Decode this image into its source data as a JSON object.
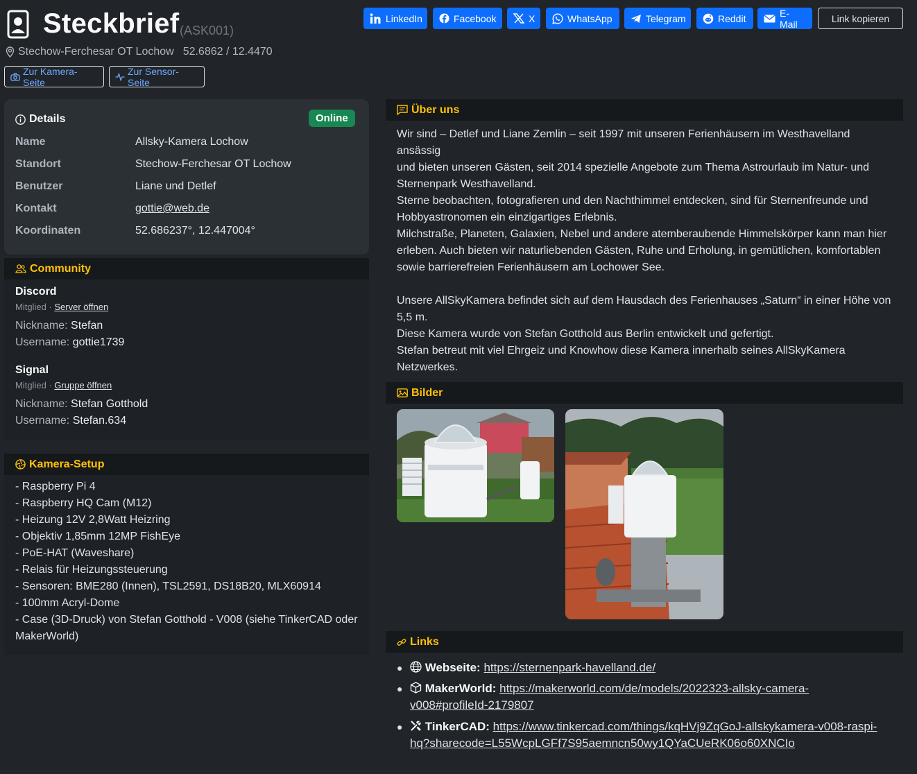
{
  "header": {
    "title": "Steckbrief",
    "camera_id": "(ASK001)",
    "location": "Stechow-Ferchesar OT Lochow",
    "coords_short": "52.6862 / 12.4470",
    "nav": {
      "camera_page": "Zur Kamera-Seite",
      "sensor_page": "Zur Sensor-Seite"
    }
  },
  "share": [
    {
      "label": "LinkedIn",
      "icon": "linkedin-icon"
    },
    {
      "label": "Facebook",
      "icon": "facebook-icon"
    },
    {
      "label": "X",
      "icon": "x-icon"
    },
    {
      "label": "WhatsApp",
      "icon": "whatsapp-icon"
    },
    {
      "label": "Telegram",
      "icon": "telegram-icon"
    },
    {
      "label": "Reddit",
      "icon": "reddit-icon"
    },
    {
      "label": "E-Mail",
      "icon": "envelope-icon"
    },
    {
      "label": "Link kopieren",
      "icon": ""
    }
  ],
  "details": {
    "title": "Details",
    "status": "Online",
    "rows": [
      {
        "k": "Name",
        "v": "Allsky-Kamera Lochow"
      },
      {
        "k": "Standort",
        "v": "Stechow-Ferchesar OT Lochow"
      },
      {
        "k": "Benutzer",
        "v": "Liane und Detlef"
      },
      {
        "k": "Kontakt",
        "v": "gottie@web.de"
      },
      {
        "k": "Koordinaten",
        "v": "52.686237°, 12.447004°"
      }
    ]
  },
  "community": {
    "title": "Community",
    "groups": [
      {
        "name": "Discord",
        "role": "Mitglied · ",
        "link": "Server öffnen",
        "nick_label": "Nickname: ",
        "nick": "Stefan",
        "user_label": "Username: ",
        "user": "gottie1739"
      },
      {
        "name": "Signal",
        "role": "Mitglied · ",
        "link": "Gruppe öffnen",
        "nick_label": "Nickname: ",
        "nick": "Stefan Gotthold",
        "user_label": "Username: ",
        "user": "Stefan.634"
      }
    ]
  },
  "setup": {
    "title": "Kamera-Setup",
    "items": [
      "- Raspberry Pi 4",
      "- Raspberry HQ Cam (M12)",
      "- Heizung 12V 2,8Watt Heizring",
      "- Objektiv 1,85mm 12MP FishEye",
      "- PoE-HAT (Waveshare)",
      "- Relais für Heizungssteuerung",
      "- Sensoren: BME280 (Innen), TSL2591, DS18B20, MLX60914",
      "- 100mm Acryl-Dome",
      "- Case (3D-Druck) von Stefan Gotthold - V008 (siehe TinkerCAD oder",
      "MakerWorld)"
    ]
  },
  "about": {
    "title": "Über uns",
    "lines": [
      "Wir sind – Detlef und Liane Zemlin – seit 1997 mit unseren Ferienhäusern im Westhavelland ansässig",
      "und bieten unseren Gästen, seit 2014 spezielle Angebote zum Thema Astrourlaub im Natur- und",
      "Sternenpark Westhavelland.",
      "Sterne beobachten, fotografieren und den Nachthimmel entdecken, sind für Sternenfreunde und",
      "Hobbyastronomen ein einzigartiges Erlebnis.",
      "Milchstraße, Planeten, Galaxien, Nebel und andere atemberaubende Himmelskörper kann man hier",
      "erleben. Auch bieten wir naturliebenden Gästen, Ruhe und Erholung, in gemütlichen, komfortablen",
      "sowie barrierefreien Ferienhäusern am Lochower See.",
      "",
      "Unsere AllSkyKamera befindet sich auf dem Hausdach des Ferienhauses „Saturn“ in einer Höhe von",
      "5,5 m.",
      "Diese Kamera wurde von Stefan Gotthold aus Berlin entwickelt und gefertigt.",
      "Stefan betreut mit viel Ehrgeiz und Knowhow diese Kamera innerhalb seines AllSkyKamera",
      "Netzwerkes."
    ]
  },
  "images": {
    "title": "Bilder"
  },
  "links": {
    "title": "Links",
    "items": [
      {
        "label": "Webseite:",
        "url": "https://sternenpark-havelland.de/",
        "url2": "",
        "icon": "globe-icon"
      },
      {
        "label": "MakerWorld:",
        "url": "https://makerworld.com/de/models/2022323-allsky-camera-",
        "url2": "v008#profileId-2179807",
        "icon": "box-icon"
      },
      {
        "label": "TinkerCAD:",
        "url": "https://www.tinkercad.com/things/kqHVj9ZqGoJ-allskykamera-v008-raspi-",
        "url2": "hq?sharecode=L55WcpLGFf7S95aemncn50wy1QYaCUeRK06o60XNCIo",
        "icon": "tools-icon"
      }
    ]
  }
}
